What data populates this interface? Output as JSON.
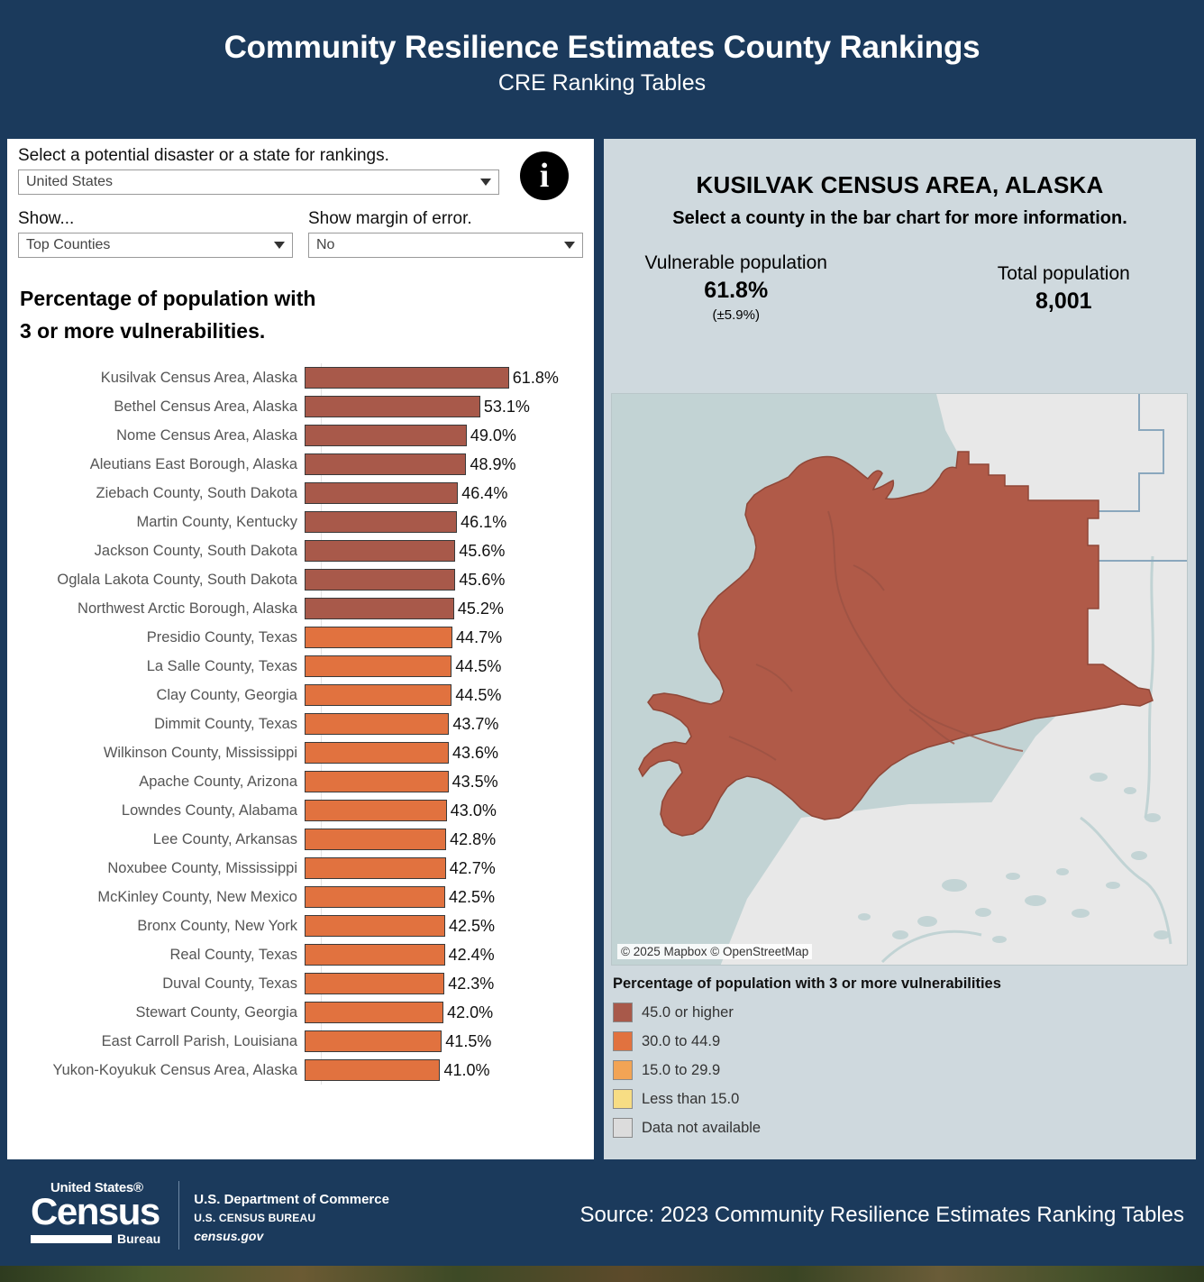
{
  "header": {
    "title": "Community Resilience Estimates County Rankings",
    "subtitle": "CRE Ranking Tables"
  },
  "controls": {
    "disaster_label": "Select a potential disaster or a state for rankings.",
    "disaster_value": "United States",
    "show_label": "Show...",
    "show_value": "Top Counties",
    "moe_label": "Show margin of error.",
    "moe_value": "No",
    "info_glyph": "i"
  },
  "chart_title_line1": "Percentage of population with",
  "chart_title_line2": "3 or more vulnerabilities.",
  "chart_data": {
    "type": "bar",
    "orientation": "horizontal",
    "title": "Percentage of population with 3 or more vulnerabilities.",
    "xlabel": "",
    "ylabel": "",
    "xlim": [
      0,
      61.8
    ],
    "grid": false,
    "legend_position": "right-panel",
    "categories": [
      "Kusilvak Census Area, Alaska",
      "Bethel Census Area, Alaska",
      "Nome Census Area, Alaska",
      "Aleutians East Borough, Alaska",
      "Ziebach County, South Dakota",
      "Martin County, Kentucky",
      "Jackson County, South Dakota",
      "Oglala Lakota County, South Dakota",
      "Northwest Arctic Borough, Alaska",
      "Presidio County, Texas",
      "La Salle County, Texas",
      "Clay County, Georgia",
      "Dimmit County, Texas",
      "Wilkinson County, Mississippi",
      "Apache County, Arizona",
      "Lowndes County, Alabama",
      "Lee County, Arkansas",
      "Noxubee County, Mississippi",
      "McKinley County, New Mexico",
      "Bronx County, New York",
      "Real County, Texas",
      "Duval County, Texas",
      "Stewart County, Georgia",
      "East Carroll Parish, Louisiana",
      "Yukon-Koyukuk Census Area, Alaska"
    ],
    "values": [
      61.8,
      53.1,
      49.0,
      48.9,
      46.4,
      46.1,
      45.6,
      45.6,
      45.2,
      44.7,
      44.5,
      44.5,
      43.7,
      43.6,
      43.5,
      43.0,
      42.8,
      42.7,
      42.5,
      42.5,
      42.4,
      42.3,
      42.0,
      41.5,
      41.0
    ],
    "value_labels": [
      "61.8%",
      "53.1%",
      "49.0%",
      "48.9%",
      "46.4%",
      "46.1%",
      "45.6%",
      "45.6%",
      "45.2%",
      "44.7%",
      "44.5%",
      "44.5%",
      "43.7%",
      "43.6%",
      "43.5%",
      "43.0%",
      "42.8%",
      "42.7%",
      "42.5%",
      "42.5%",
      "42.4%",
      "42.3%",
      "42.0%",
      "41.5%",
      "41.0%"
    ],
    "colors": [
      "#a8594a",
      "#a8594a",
      "#a8594a",
      "#a8594a",
      "#a8594a",
      "#a8594a",
      "#a8594a",
      "#a8594a",
      "#a8594a",
      "#e1723f",
      "#e1723f",
      "#e1723f",
      "#e1723f",
      "#e1723f",
      "#e1723f",
      "#e1723f",
      "#e1723f",
      "#e1723f",
      "#e1723f",
      "#e1723f",
      "#e1723f",
      "#e1723f",
      "#e1723f",
      "#e1723f",
      "#e1723f"
    ]
  },
  "detail": {
    "county_title": "KUSILVAK CENSUS AREA, ALASKA",
    "instruction": "Select a county in the bar chart for more information.",
    "vulnerable_label": "Vulnerable population",
    "vulnerable_value": "61.8%",
    "vulnerable_moe": "(±5.9%)",
    "total_label": "Total population",
    "total_value": "8,001",
    "map_attribution": "© 2025 Mapbox  © OpenStreetMap"
  },
  "legend": {
    "title": "Percentage of population with 3 or more vulnerabilities",
    "items": [
      {
        "label": "45.0 or higher",
        "color": "#a8594a"
      },
      {
        "label": "30.0 to 44.9",
        "color": "#e1723f"
      },
      {
        "label": "15.0 to 29.9",
        "color": "#f2a455"
      },
      {
        "label": "Less than 15.0",
        "color": "#f7dd84"
      },
      {
        "label": "Data not available",
        "color": "#dcdcdc"
      }
    ]
  },
  "footer": {
    "logo_line1": "United States®",
    "logo_line2": "Census",
    "logo_line3": "Bureau",
    "dept_line1": "U.S. Department of Commerce",
    "dept_line2": "U.S. CENSUS BUREAU",
    "dept_line3": "census.gov",
    "source": "Source: 2023 Community Resilience Estimates Ranking Tables"
  },
  "theme": {
    "brand_navy": "#1b3a5c",
    "panel_blue": "#cfd9de",
    "map_water": "#c2d3d4",
    "map_land": "#e8e8e8",
    "map_county_fill": "#b05a48"
  }
}
